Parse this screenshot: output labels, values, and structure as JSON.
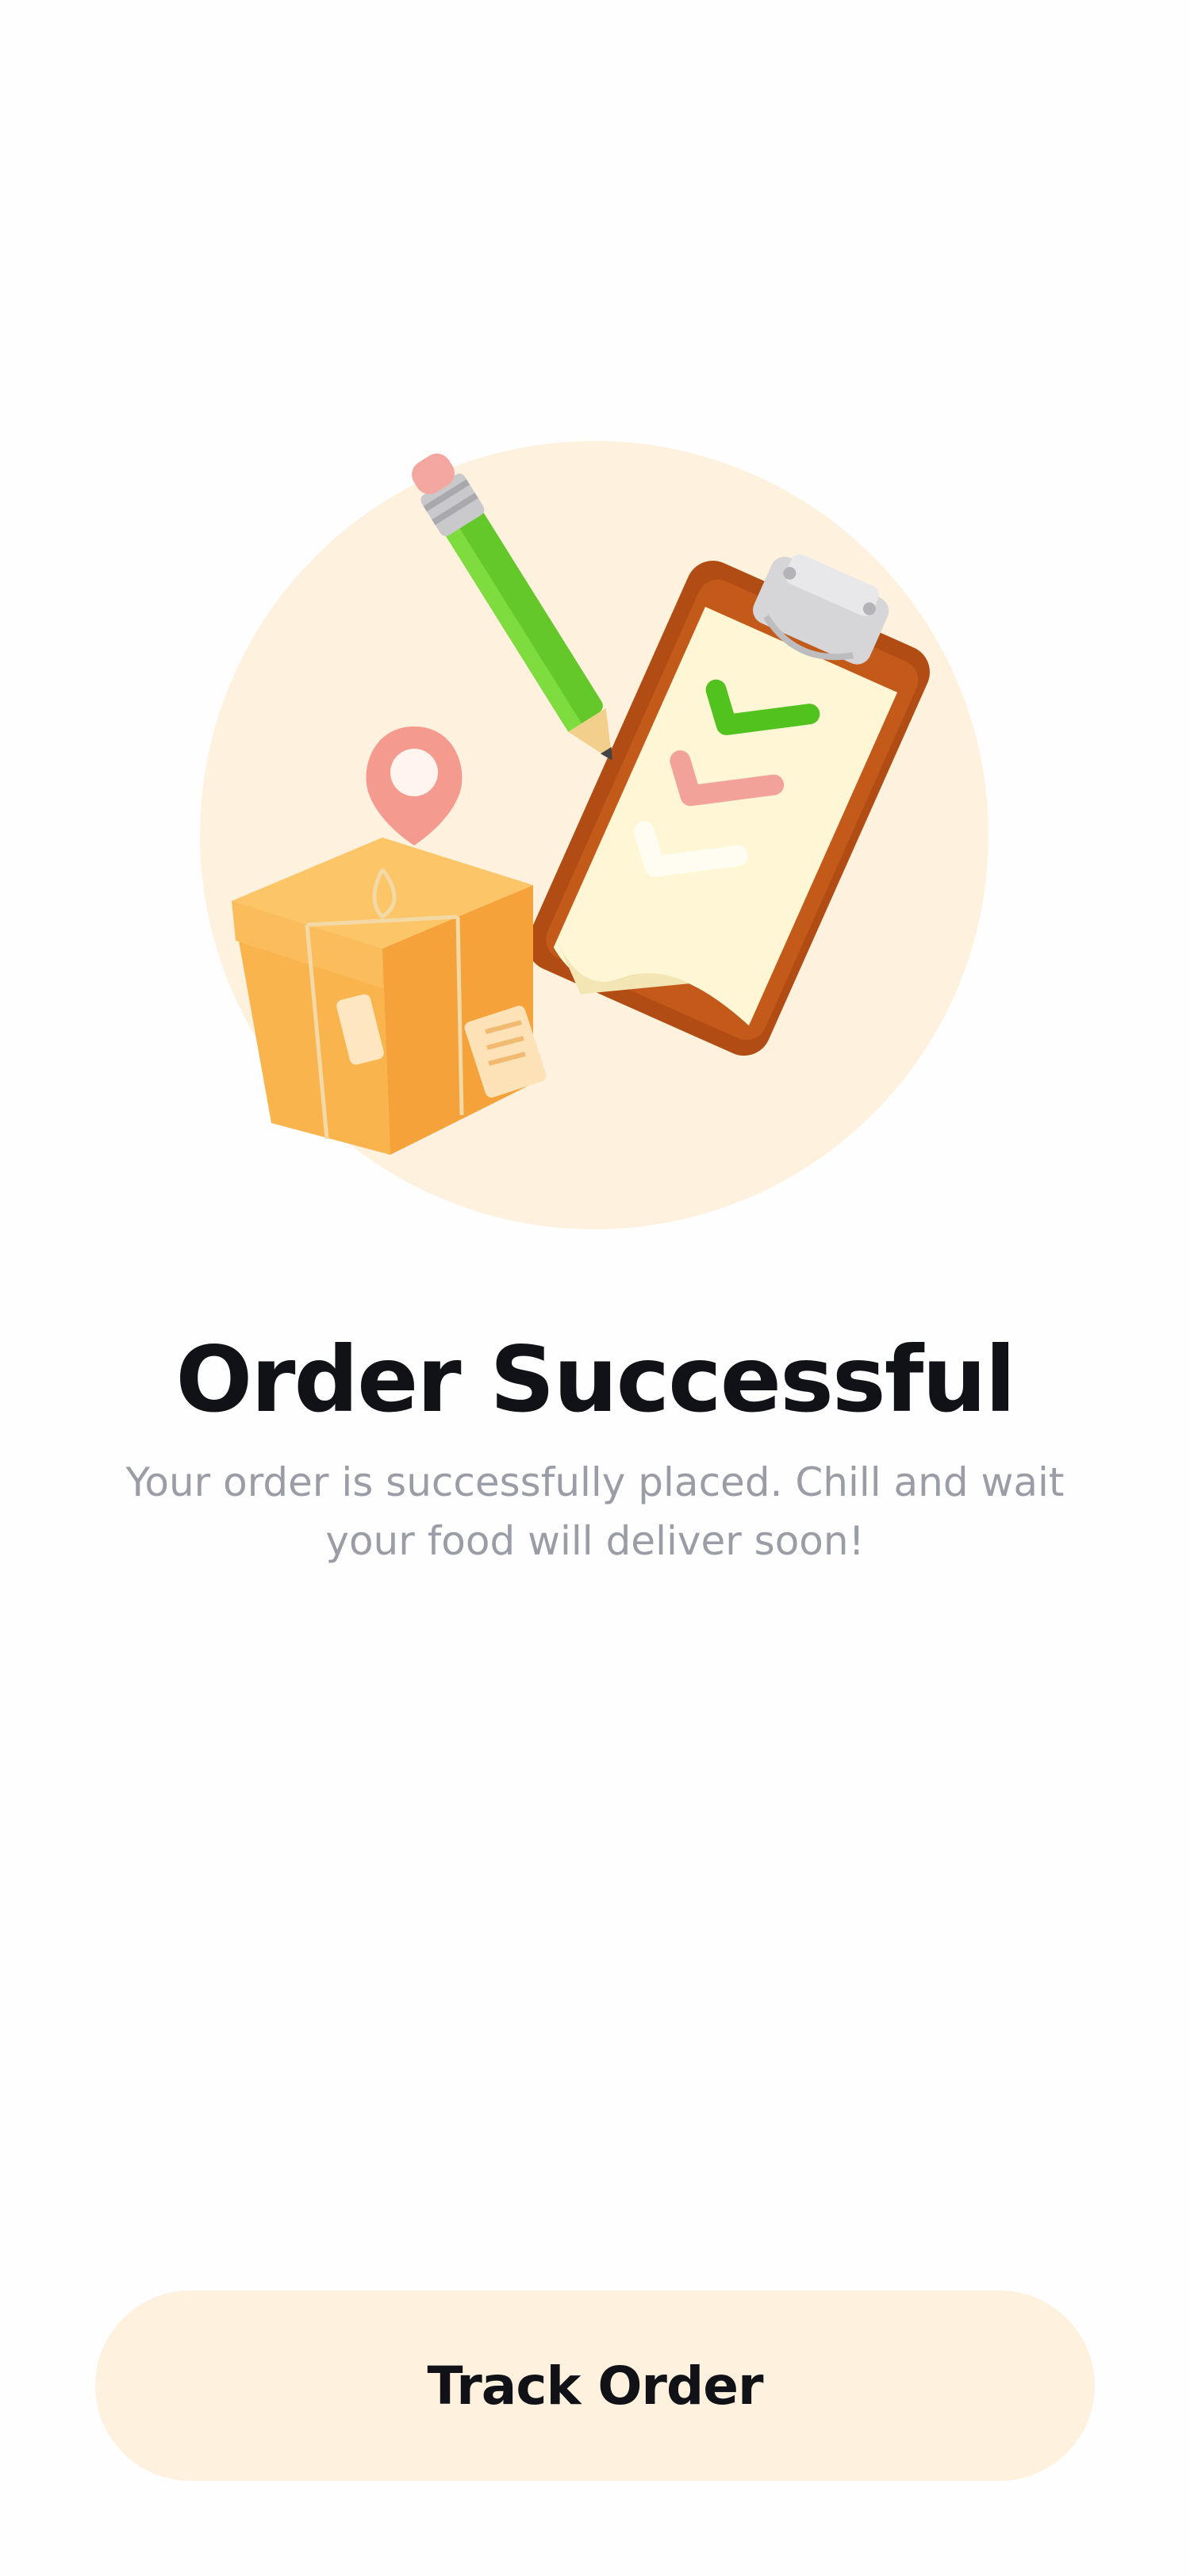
{
  "screen": {
    "title": "Order Successful",
    "message": "Your order is successfully placed. Chill and wait your food will deliver soon!"
  },
  "actions": {
    "track_order_label": "Track Order"
  },
  "illustration": {
    "icons": [
      "location-pin-icon",
      "package-box-icon",
      "pencil-icon",
      "clipboard-checklist-icon"
    ]
  },
  "colors": {
    "accent_background": "#fef2df",
    "title": "#101218",
    "subtitle": "#9a9ca6",
    "box": "#f7ac45",
    "clipboard": "#b14d14",
    "pencil": "#64c82a",
    "pin": "#f59a8e"
  }
}
